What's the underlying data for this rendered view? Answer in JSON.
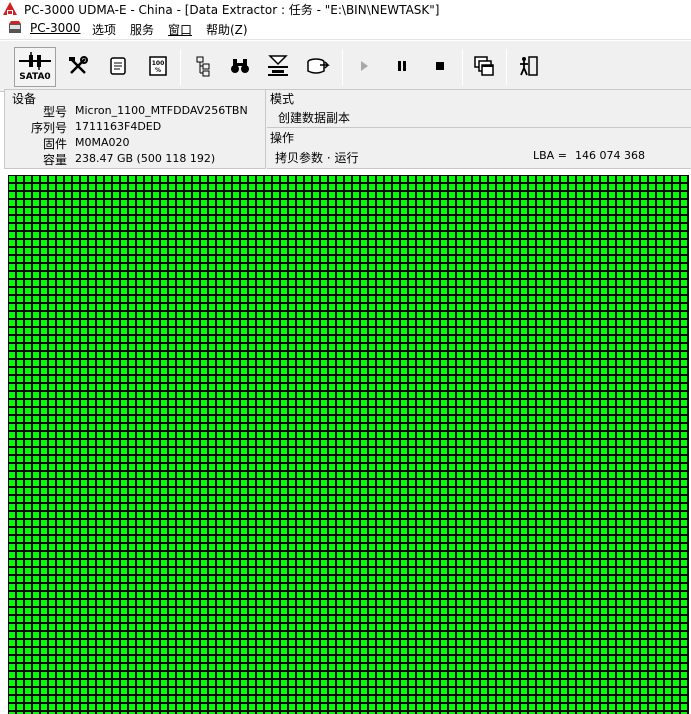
{
  "window": {
    "title": "PC-3000 UDMA-E - China - [Data Extractor : 任务 - \"E:\\BIN\\NEWTASK\"]"
  },
  "menu": {
    "items": [
      "PC-3000",
      "选项",
      "服务",
      "窗口",
      "帮助(Z)"
    ]
  },
  "toolbar": {
    "port_label": "SATA0",
    "icons": [
      "sata-port-icon",
      "tools-icon",
      "scroll-icon",
      "percent-icon",
      "tree-icon",
      "binoculars-icon",
      "filter-icon",
      "export-icon",
      "play-icon",
      "pause-icon",
      "stop-icon",
      "windows-icon",
      "exit-icon"
    ]
  },
  "device": {
    "header": "设备",
    "model_label": "型号",
    "model_value": "Micron_1100_MTFDDAV256TBN",
    "serial_label": "序列号",
    "serial_value": "1711163F4DED",
    "firmware_label": "固件",
    "firmware_value": "M0MA020",
    "capacity_label": "容量",
    "capacity_value": "238.47 GB (500 118 192)"
  },
  "mode": {
    "header": "模式",
    "value": "创建数据副本"
  },
  "operation": {
    "header": "操作",
    "value": "拷贝参数 · 运行",
    "lba_label": "LBA =",
    "lba_value": "146 074 368"
  },
  "sector_map": {
    "block_color": "#00ff00",
    "border_color": "#000000",
    "status": "all blocks read"
  },
  "colors": {
    "toolbar_bg": "#f0f0f0",
    "accent_red": "#d42020"
  }
}
